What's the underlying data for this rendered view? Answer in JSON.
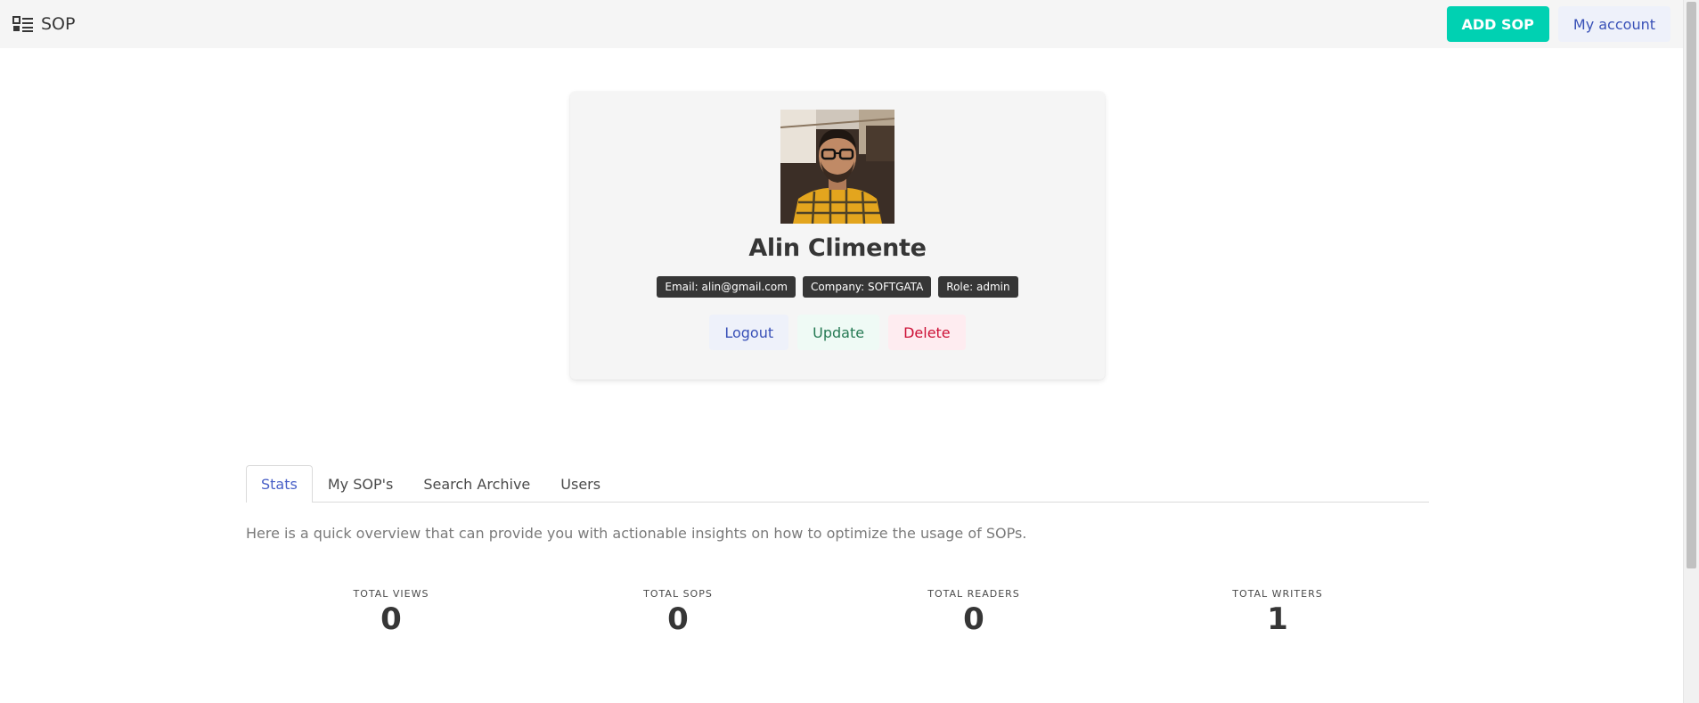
{
  "navbar": {
    "brand": "SOP",
    "brand_icon": "list-icon",
    "add_label": "ADD SOP",
    "account_label": "My account"
  },
  "colors": {
    "primary": "#00d1b2",
    "link": "#485fc7",
    "success_text": "#257953",
    "danger_text": "#cc0f35",
    "dark_tag": "#363636"
  },
  "profile": {
    "name": "Alin Climente",
    "tags": {
      "email": "Email: alin@gmail.com",
      "company": "Company: SOFTGATA",
      "role": "Role: admin"
    },
    "actions": {
      "logout": "Logout",
      "update": "Update",
      "delete": "Delete"
    }
  },
  "tabs": {
    "stats": "Stats",
    "my_sops": "My SOP's",
    "search_archive": "Search Archive",
    "users": "Users"
  },
  "overview": "Here is a quick overview that can provide you with actionable insights on how to optimize the usage of SOPs.",
  "stats": [
    {
      "heading": "TOTAL VIEWS",
      "value": "0"
    },
    {
      "heading": "TOTAL SOPS",
      "value": "0"
    },
    {
      "heading": "TOTAL READERS",
      "value": "0"
    },
    {
      "heading": "TOTAL WRITERS",
      "value": "1"
    }
  ]
}
